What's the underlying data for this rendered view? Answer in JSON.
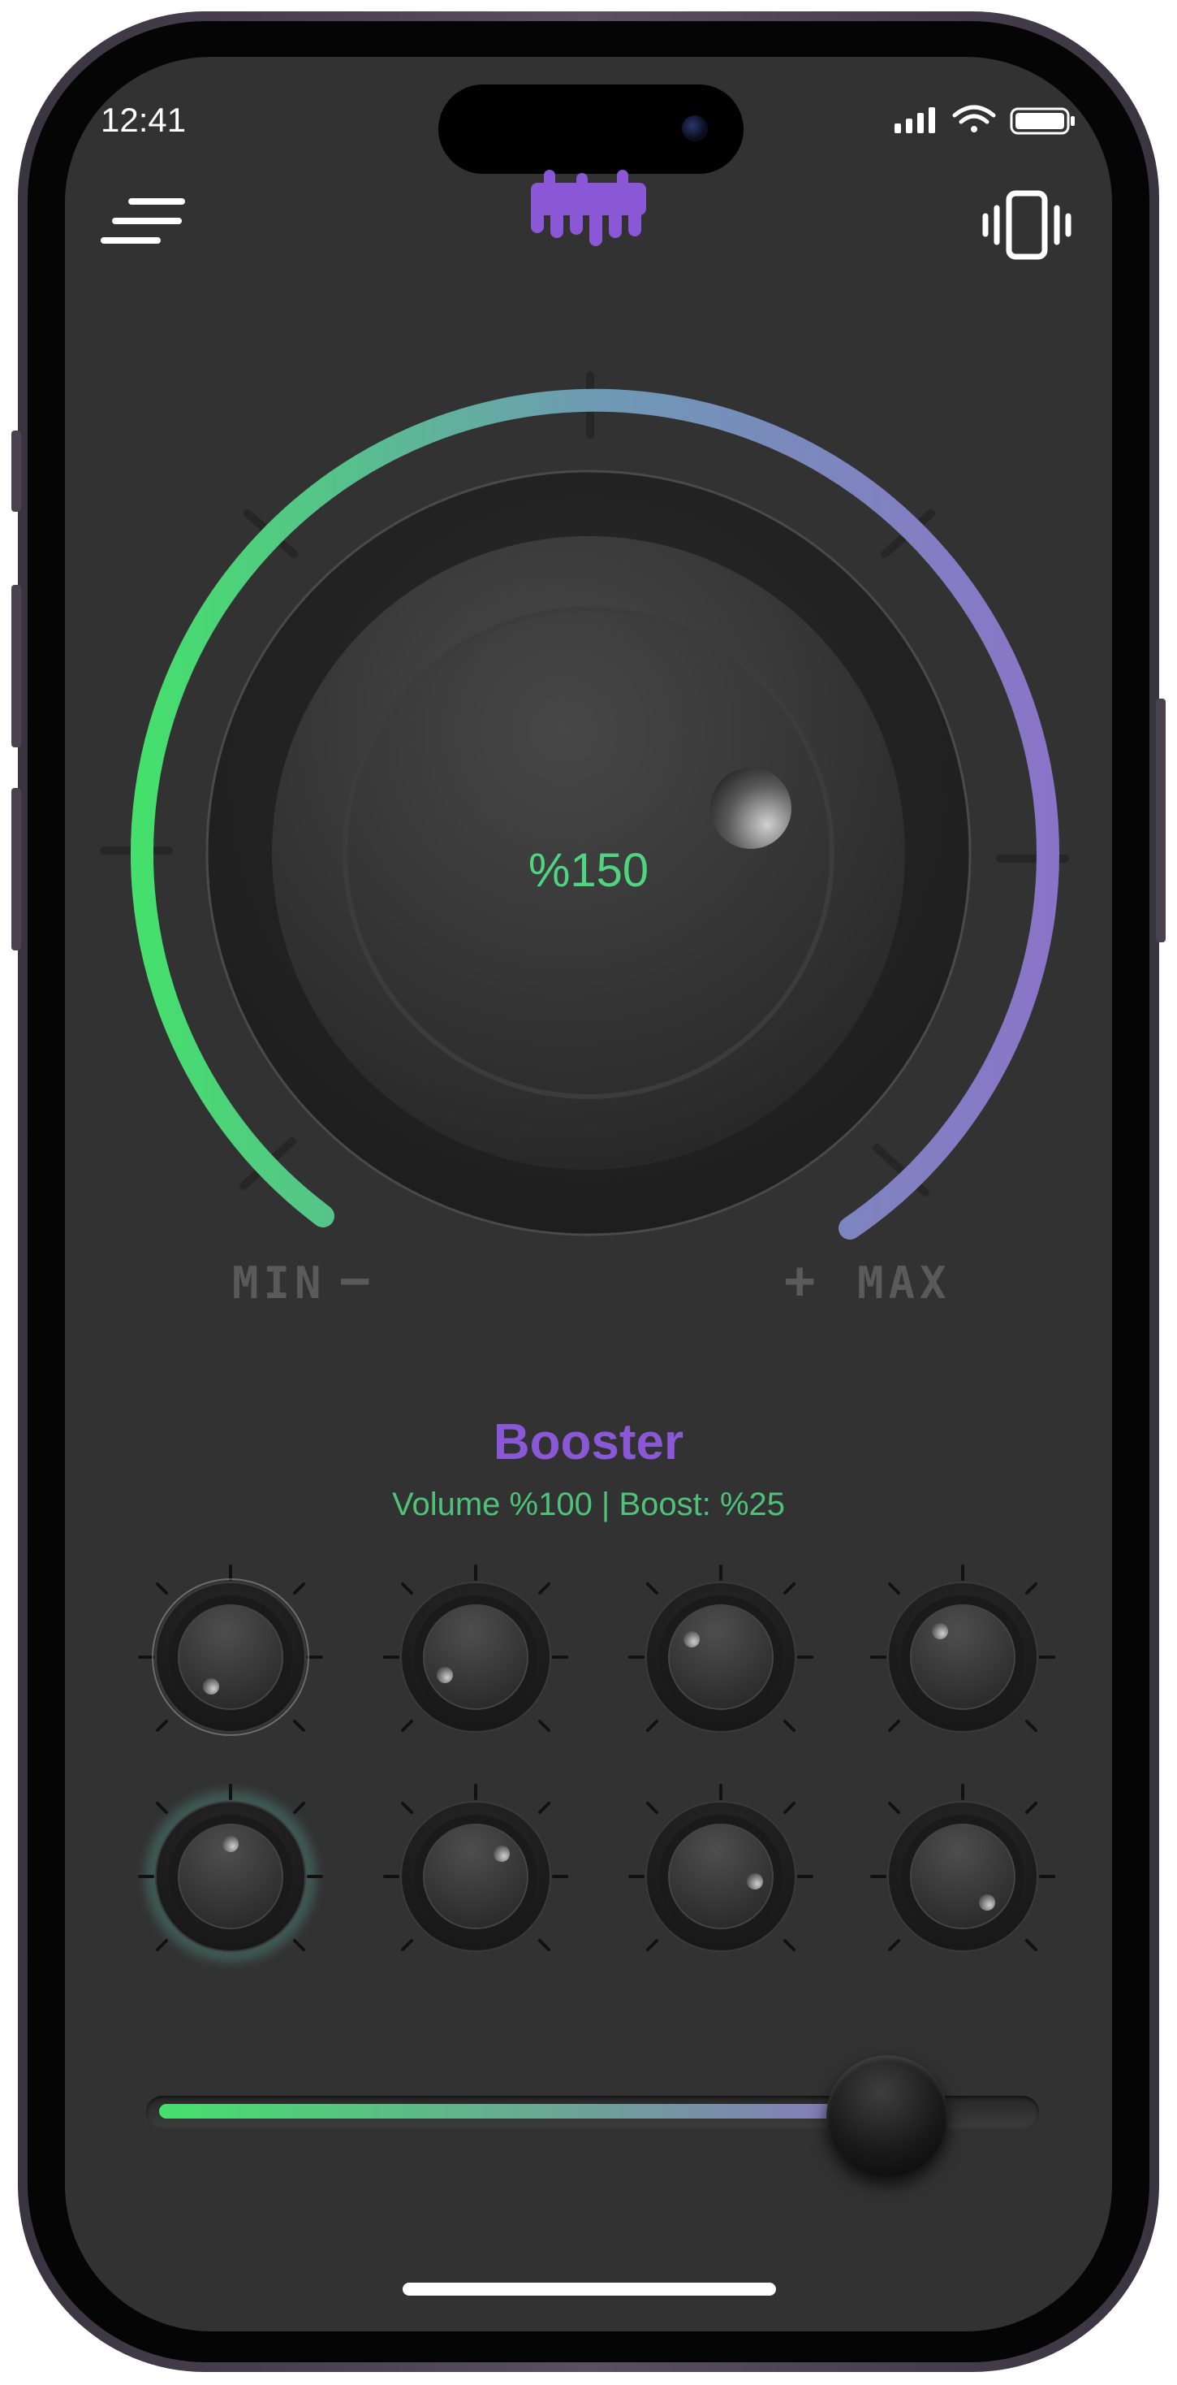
{
  "status_bar": {
    "time": "12:41"
  },
  "header": {
    "menu_icon": "menu-lines-icon",
    "logo_icon": "sound-wave-logo-icon",
    "vibrate_icon": "vibrate-phone-icon"
  },
  "main_knob": {
    "value_text": "%150",
    "level_percent": 75,
    "min_label": "MIN",
    "max_label": "MAX",
    "minus_symbol": "−",
    "plus_symbol": "+"
  },
  "preset": {
    "title": "Booster",
    "subtitle": "Volume %100 | Boost: %25"
  },
  "slider": {
    "level_percent": 84
  },
  "colors": {
    "background": "#323232",
    "accent_green": "#45e06c",
    "accent_purple": "#8a58d6",
    "arc_blue": "#7190b8",
    "value_green": "#4fd480"
  }
}
